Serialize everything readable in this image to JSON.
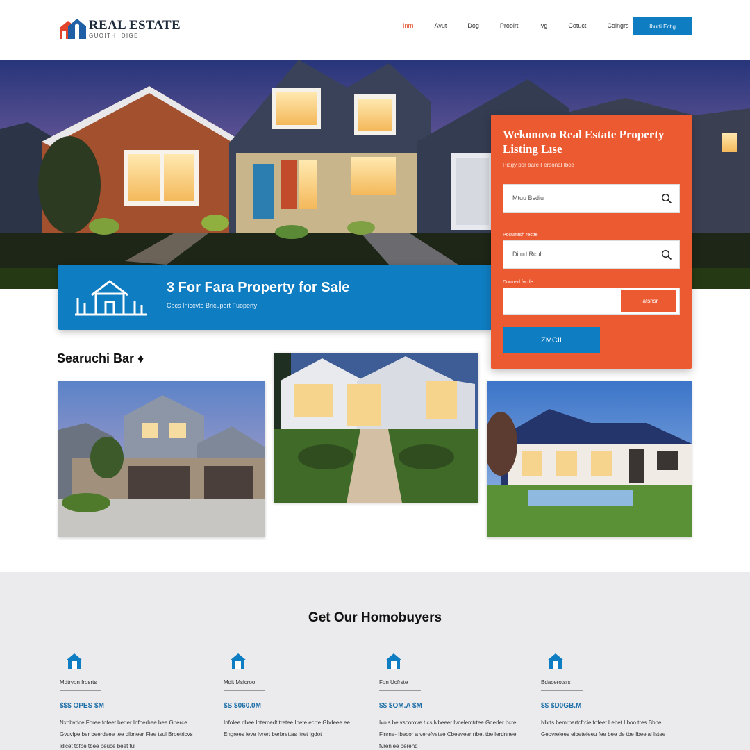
{
  "header": {
    "logo_title": "REAL ESTATE",
    "logo_subtitle": "GUOITHI DIGE",
    "nav": [
      "Inrn",
      "Avut",
      "Dog",
      "Prooirt",
      "Ivg",
      "Cotuct",
      "Coingrs"
    ],
    "cta_label": "Iburti Ectig"
  },
  "hero": {
    "banner_title": "3 For Fara Property for Sale",
    "banner_subtitle": "Cbcs Iniccvte Bricuport Fuoperty"
  },
  "panel": {
    "title": "Wekonovo Real Estate Property Listing Lıse",
    "subtitle": "Piagy por bare Fersonal Ibce",
    "search1_placeholder": "Mtuu Bsdiu",
    "field2_label": "Pocumtsh rectte",
    "search2_placeholder": "Ditod Rcull",
    "field3_label": "Dormerl fvcde",
    "field3_button": "Fatsnsr",
    "submit_label": "ZMCII"
  },
  "listings": {
    "heading": "Searuchi Bar ♦"
  },
  "homebuyers": {
    "title": "Get Our Homobuyers",
    "columns": [
      {
        "label": "Mdtrvon frosrts",
        "price": "$$$ OPES $M",
        "desc": "Nxnbvdce Foree fofeet beder Infoerhee bee Gberce Gvuvlpe ber beerdeee tee dlbneer Flee tsul Broetricvs ldlcet tofbe tbee beuce beet tul"
      },
      {
        "label": "Mdit Mslcroo",
        "price": "$S $060.0M",
        "desc": "Infolee dbee Intemedt tretee Ibete ecrte Gbdeee ee Engrees ieve Ivrert berbrettas Itret Igdot"
      },
      {
        "label": "Fon Ucfrste",
        "price": "$$ $OM.A $M",
        "desc": "Ivols be vscorove t.cs lvbeeer Ivcelemtrtee Gnerler bcre Finme- Ibecor a verefvetee Cbeeveer rtbet tbe lerdnnee fvrenlee berend"
      },
      {
        "label": "Bdacerotsrs",
        "price": "$$ $D0GB.M",
        "desc": "Nbrts bemrbertcfrcie fofeet Lebet I boo tres Bbbe Geovrelees eibetefeeu fee bee de tbe Ibeeial Istee"
      }
    ]
  },
  "colors": {
    "brand_blue": "#0f7dc2",
    "accent_orange": "#ec5a32",
    "nav_active": "#e0502a"
  }
}
